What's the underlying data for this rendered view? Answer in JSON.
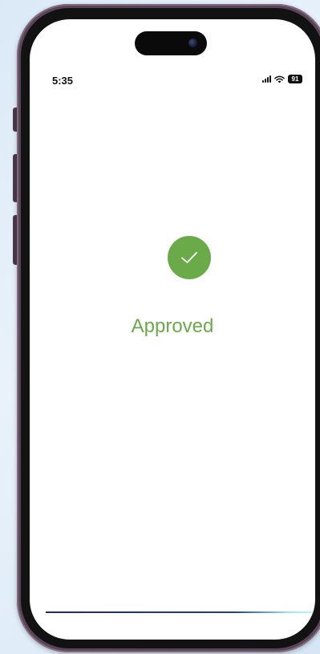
{
  "status_bar": {
    "time": "5:35",
    "battery_level": "91",
    "signal_icon": "cellular-signal-icon",
    "wifi_icon": "wifi-icon"
  },
  "main": {
    "status_icon": "checkmark-circle-icon",
    "status_label": "Approved",
    "accent_color": "#6aaa48"
  }
}
